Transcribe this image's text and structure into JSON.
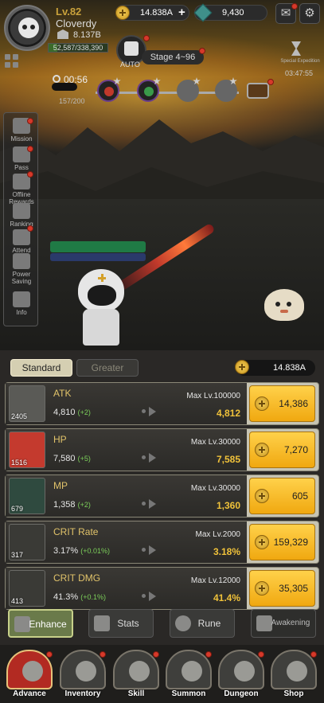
{
  "player": {
    "level": "Lv.82",
    "name": "Cloverdy",
    "power": "8.137B",
    "exp": "52,587/338,390",
    "exp_fraction": 0.155
  },
  "currencies": {
    "gold": "14.838A",
    "gems": "9,430"
  },
  "battle": {
    "auto_label": "AUTO",
    "stage": "Stage 4~96",
    "timer": "00:56",
    "kills": "157/200",
    "event_label": "Special Expedition",
    "event_timer": "03:47:55"
  },
  "side_menu": [
    {
      "label": "Mission"
    },
    {
      "label": "Pass"
    },
    {
      "label": "Offline Rewards"
    },
    {
      "label": "Ranking"
    },
    {
      "label": "Attend"
    },
    {
      "label": "Power Saving"
    },
    {
      "label": "Info"
    }
  ],
  "enhance": {
    "tabs": [
      {
        "label": "Standard",
        "active": true
      },
      {
        "label": "Greater",
        "active": false
      }
    ],
    "gold_display": "14.838A",
    "stats": [
      {
        "name": "ATK",
        "icon": "sword-icon",
        "level": "2405",
        "current": "4,810",
        "inc": "(+2)",
        "max": "Max Lv.100000",
        "next": "4,812",
        "cost": "14,386"
      },
      {
        "name": "HP",
        "icon": "heart-icon",
        "level": "1516",
        "current": "7,580",
        "inc": "(+5)",
        "max": "Max Lv.30000",
        "next": "7,585",
        "cost": "7,270"
      },
      {
        "name": "MP",
        "icon": "mana-icon",
        "level": "679",
        "current": "1,358",
        "inc": "(+2)",
        "max": "Max Lv.30000",
        "next": "1,360",
        "cost": "605"
      },
      {
        "name": "CRIT Rate",
        "icon": "crit-rate-icon",
        "level": "317",
        "current": "3.17%",
        "inc": "(+0.01%)",
        "max": "Max Lv.2000",
        "next": "3.18%",
        "cost": "159,329"
      },
      {
        "name": "CRIT DMG",
        "icon": "crit-dmg-icon",
        "level": "413",
        "current": "41.3%",
        "inc": "(+0.1%)",
        "max": "Max Lv.12000",
        "next": "41.4%",
        "cost": "35,305"
      }
    ]
  },
  "subnav": [
    {
      "label": "Enhance",
      "active": true
    },
    {
      "label": "Stats",
      "active": false
    },
    {
      "label": "Rune",
      "active": false
    },
    {
      "label": "Awakening",
      "active": false
    }
  ],
  "bottom_nav": [
    {
      "label": "Advance",
      "active": true
    },
    {
      "label": "Inventory",
      "active": false
    },
    {
      "label": "Skill",
      "active": false
    },
    {
      "label": "Summon",
      "active": false
    },
    {
      "label": "Dungeon",
      "active": false
    },
    {
      "label": "Shop",
      "active": false
    }
  ],
  "colors": {
    "accent_gold": "#f0c23a",
    "buy_button": "#ffd14a",
    "stat_name": "#e1c36a",
    "increment": "#7ccf5a"
  }
}
